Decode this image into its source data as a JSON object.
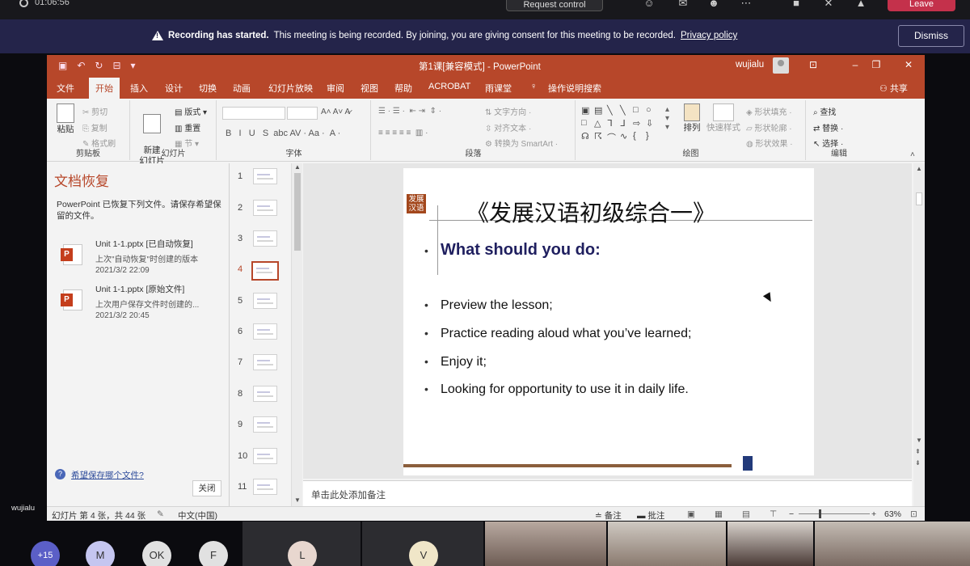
{
  "teams": {
    "timer": "01:06:56",
    "request_control": "Request control",
    "leave": "Leave",
    "banner": {
      "strong": "Recording has started.",
      "text": "This meeting is being recorded. By joining, you are giving consent for this meeting to be recorded.",
      "link": "Privacy policy",
      "dismiss": "Dismiss"
    },
    "presenter_name": "wujialu",
    "participants": {
      "overflow": "+15",
      "initials": [
        "M",
        "OK",
        "F",
        "L",
        "V"
      ]
    }
  },
  "ppt": {
    "window_title": "第1课[兼容模式] - PowerPoint",
    "user": "wujialu",
    "tabs": [
      "文件",
      "开始",
      "插入",
      "设计",
      "切换",
      "动画",
      "幻灯片放映",
      "审阅",
      "视图",
      "帮助",
      "ACROBAT",
      "雨课堂"
    ],
    "active_tab": "开始",
    "tell_me": "操作说明搜索",
    "share": "共享",
    "ribbon": {
      "clipboard": {
        "label": "剪贴板",
        "paste": "粘贴",
        "cut": "剪切",
        "copy": "复制",
        "format_painter": "格式刷"
      },
      "slides": {
        "label": "幻灯片",
        "new_slide": "新建\n幻灯片",
        "layout": "版式",
        "reset": "重置",
        "section": "节"
      },
      "font": {
        "label": "字体"
      },
      "paragraph": {
        "label": "段落",
        "text_direction": "文字方向",
        "align_text": "对齐文本",
        "smartart": "转换为 SmartArt"
      },
      "drawing": {
        "label": "绘图",
        "arrange": "排列",
        "quick_styles": "快速样式",
        "shape_fill": "形状填充",
        "shape_outline": "形状轮廓",
        "shape_effects": "形状效果"
      },
      "editing": {
        "label": "编辑",
        "find": "查找",
        "replace": "替换",
        "select": "选择"
      }
    },
    "recovery": {
      "title": "文档恢复",
      "description": "PowerPoint 已恢复下列文件。请保存希望保留的文件。",
      "files": [
        {
          "name": "Unit 1-1.pptx  [已自动恢复]",
          "desc": "上次\"自动恢复\"时创建的版本",
          "time": "2021/3/2 22:09"
        },
        {
          "name": "Unit 1-1.pptx  [原始文件]",
          "desc": "上次用户保存文件时创建的...",
          "time": "2021/3/2 20:45"
        }
      ],
      "help_link": "希望保存哪个文件?",
      "close": "关闭"
    },
    "thumbnails": [
      "1",
      "2",
      "3",
      "4",
      "5",
      "6",
      "7",
      "8",
      "9",
      "10",
      "11"
    ],
    "active_slide": "4",
    "slide": {
      "logo": "发展\n汉语",
      "title": "《发展汉语初级综合一》",
      "subheading": "What should you do:",
      "bullets": [
        "Preview the lesson;",
        "Practice reading aloud what you’ve learned;",
        "Enjoy it;",
        "Looking for opportunity to use it in daily life."
      ]
    },
    "notes_placeholder": "单击此处添加备注",
    "status": {
      "slide_count": "幻灯片 第 4 张，共 44 张",
      "language": "中文(中国)",
      "notes": "备注",
      "comments": "批注",
      "zoom": "63%"
    }
  }
}
